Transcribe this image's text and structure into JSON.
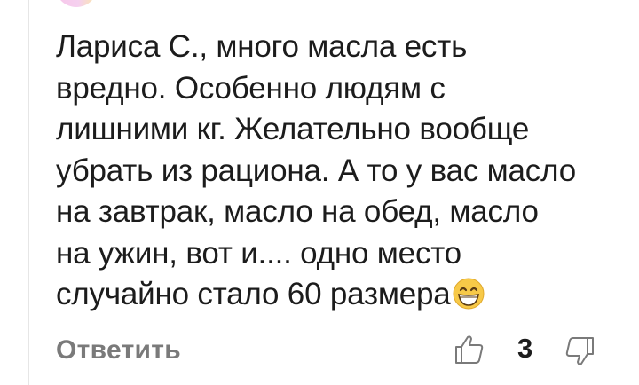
{
  "comment": {
    "text_lines": [
      "Лариса С., много масла есть",
      "вредно. Особенно людям с",
      "лишними кг. Желательно вообще",
      "убрать из рациона. А то у вас масло",
      "на завтрак, масло на обед, масло",
      "на ужин, вот и.... одно место",
      "случайно стало 60 размера"
    ],
    "emoji": "grinning-face-emoji"
  },
  "actions": {
    "reply_label": "Ответить",
    "like_icon": "thumbs-up-icon",
    "like_count": "3",
    "dislike_icon": "thumbs-down-icon"
  },
  "colors": {
    "text": "#1c1c1c",
    "secondary": "#7a7a7a",
    "rule": "#e6e6e6"
  }
}
